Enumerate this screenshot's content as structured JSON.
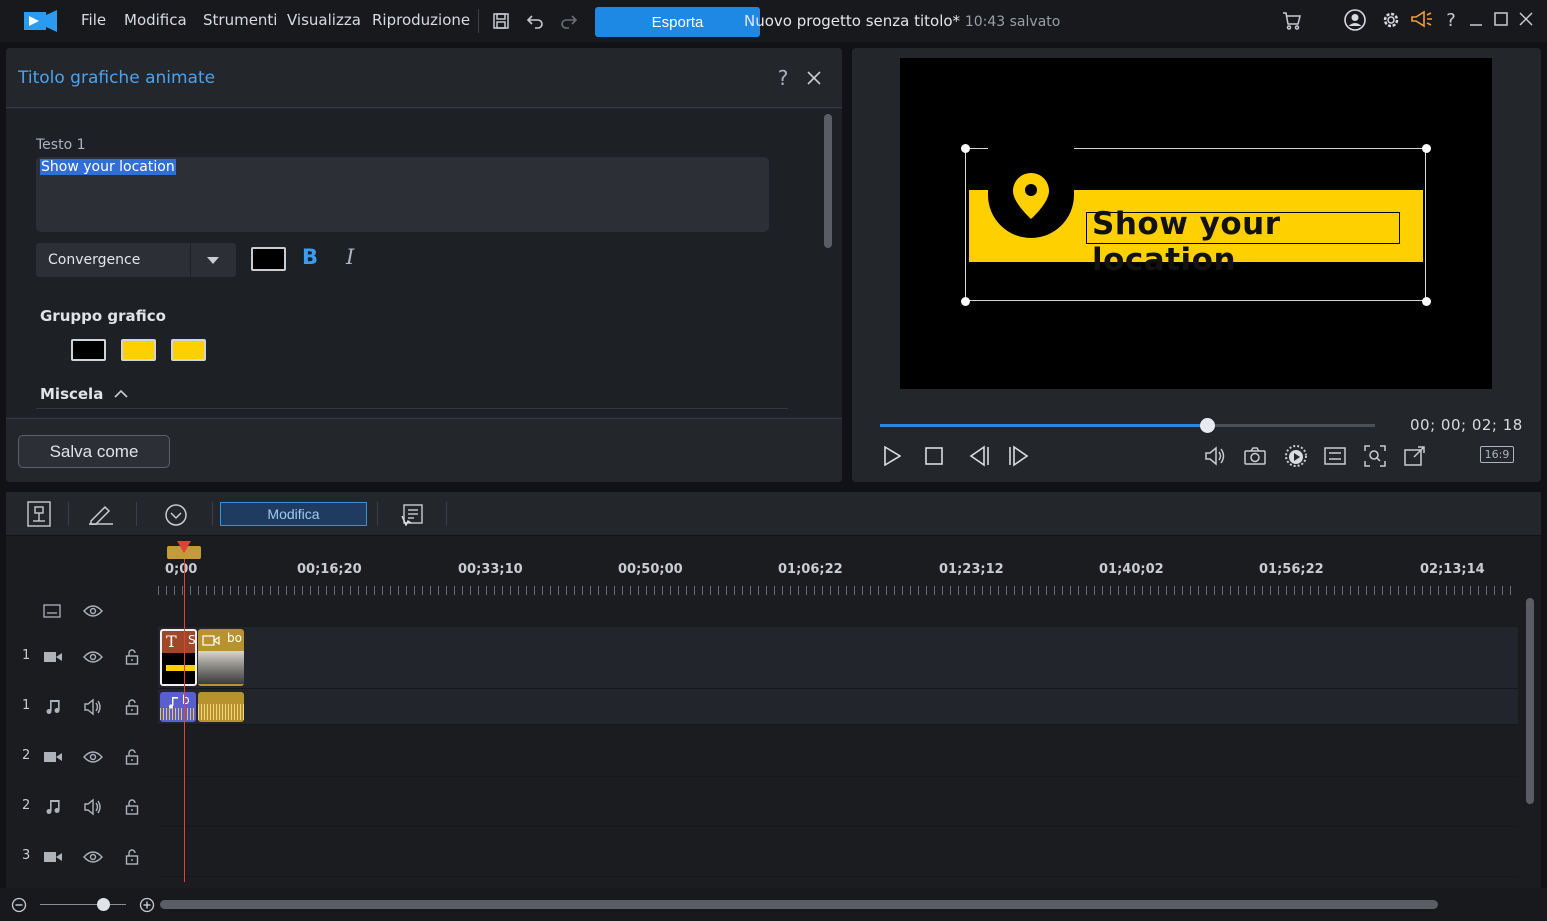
{
  "menu": [
    "File",
    "Modifica",
    "Strumenti",
    "Visualizza",
    "Riproduzione"
  ],
  "export_label": "Esporta",
  "project": {
    "title": "Nuovo progetto senza titolo*",
    "saved": "10:43 salvato"
  },
  "panel": {
    "title": "Titolo grafiche animate",
    "text_label": "Testo 1",
    "text_value": "Show your location",
    "font": "Convergence",
    "bold": "B",
    "italic": "I",
    "group_label": "Gruppo grafico",
    "group_colors": [
      "#000000",
      "#ffd000",
      "#ffd000"
    ],
    "blend_label": "Miscela",
    "save_as": "Salva come",
    "text_color": "#000000"
  },
  "preview": {
    "title_text": "Show your location",
    "timecode": "00; 00; 02; 18",
    "aspect": "16:9",
    "progress": 0.66,
    "accent_yellow": "#ffd000"
  },
  "timeline": {
    "modifica_label": "Modifica",
    "ruler": [
      "0;00",
      "00;16;20",
      "00;33;10",
      "00;50;00",
      "01;06;22",
      "01;23;12",
      "01;40;02",
      "01;56;22",
      "02;13;14"
    ],
    "tracks": [
      {
        "num": "1",
        "type": "video"
      },
      {
        "num": "1",
        "type": "audio"
      },
      {
        "num": "2",
        "type": "video"
      },
      {
        "num": "2",
        "type": "audio"
      },
      {
        "num": "3",
        "type": "video"
      }
    ],
    "clips": {
      "title_clip": "S",
      "video_clip": "bo",
      "audio_clip": "b"
    }
  },
  "icons": [
    "app-logo-icon",
    "save-icon",
    "undo-icon",
    "redo-icon",
    "cart-icon",
    "account-icon",
    "settings-icon",
    "megaphone-icon",
    "help-icon",
    "minimize-icon",
    "maximize-icon",
    "close-icon"
  ]
}
